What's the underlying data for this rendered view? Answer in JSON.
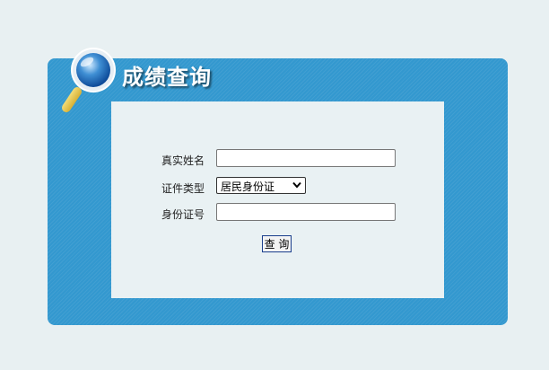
{
  "header": {
    "title": "成绩查询"
  },
  "form": {
    "name_label": "真实姓名",
    "name_value": "",
    "id_type_label": "证件类型",
    "id_type_selected": "居民身份证",
    "id_number_label": "身份证号",
    "id_number_value": "",
    "submit_label": "查 询"
  },
  "colors": {
    "page_background": "#e8f0f2",
    "panel_blue": "#3398cf",
    "form_background": "#e9f1f3",
    "button_border": "#1a3e8c"
  }
}
